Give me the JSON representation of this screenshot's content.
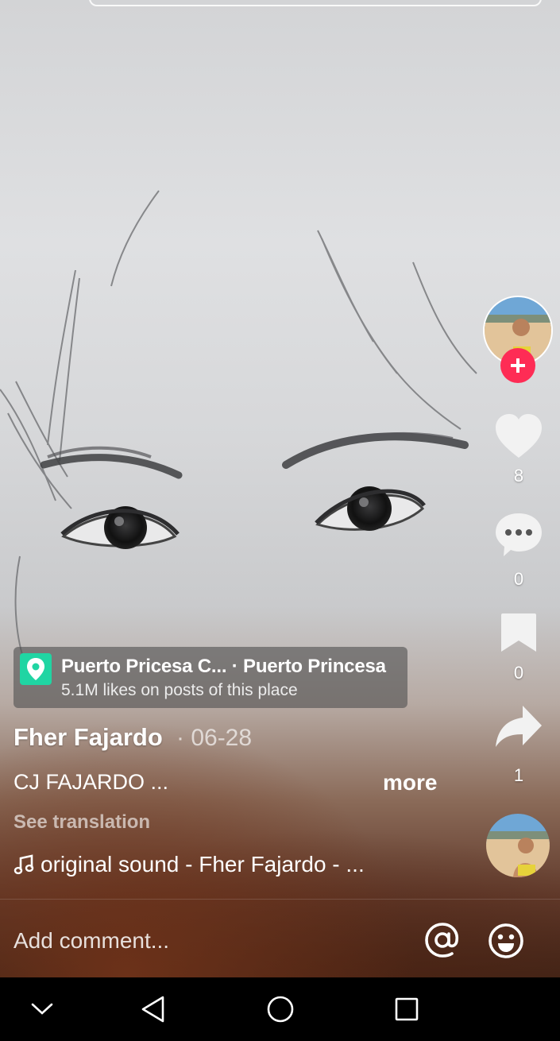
{
  "rail": {
    "like_count": "8",
    "comment_count": "0",
    "save_count": "0",
    "share_count": "1"
  },
  "location": {
    "name": "Puerto Pricesa C... · Puerto Princesa",
    "subtitle": "5.1M likes on posts of this place"
  },
  "post": {
    "author": "Fher Fajardo",
    "date": "· 06-28",
    "caption": "CJ FAJARDO ...",
    "more_label": "more",
    "see_translation": "See translation",
    "sound": "original sound - Fher Fajardo - ..."
  },
  "comment": {
    "placeholder": "Add comment..."
  },
  "colors": {
    "follow": "#fe2c55",
    "location_pin": "#20d5a3"
  },
  "icons": [
    "heart-icon",
    "comment-icon",
    "bookmark-icon",
    "share-icon",
    "music-note-icon",
    "at-icon",
    "emoji-icon",
    "location-pin-icon"
  ]
}
